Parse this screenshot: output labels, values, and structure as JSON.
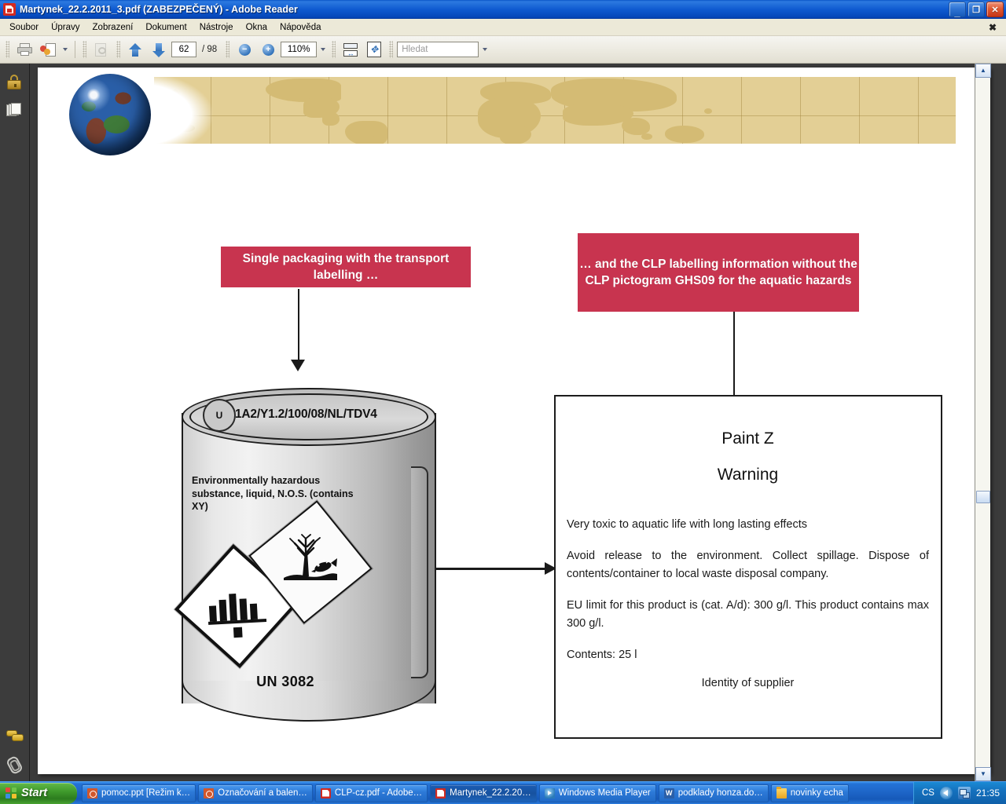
{
  "window": {
    "title": "Martynek_22.2.2011_3.pdf (ZABEZPEČENÝ) - Adobe Reader",
    "app_icon": "pdf-document-icon",
    "minimize_glyph": "_",
    "restore_glyph": "❐",
    "close_glyph": "✕"
  },
  "menu": {
    "items": [
      {
        "label": "Soubor"
      },
      {
        "label": "Úpravy"
      },
      {
        "label": "Zobrazení"
      },
      {
        "label": "Dokument"
      },
      {
        "label": "Nástroje"
      },
      {
        "label": "Okna"
      },
      {
        "label": "Nápověda"
      }
    ],
    "close_document_glyph": "✖"
  },
  "toolbar": {
    "print_icon": "printer-icon",
    "send_for_review_icon": "send-for-review-icon",
    "email_icon": "email-attach-icon",
    "previous_page_icon": "arrow-up-icon",
    "next_page_icon": "arrow-down-icon",
    "page_number": "62",
    "page_total": "/ 98",
    "zoom_out_glyph": "−",
    "zoom_in_glyph": "+",
    "zoom_value": "110%",
    "zoom_dropdown_icon": "chevron-down-icon",
    "fit_width_icon": "fit-width-icon",
    "fit_page_icon": "fit-page-icon",
    "search_placeholder": "Hledat",
    "search_value": "",
    "search_dropdown_icon": "chevron-down-icon"
  },
  "navigation_pane": {
    "items": [
      {
        "name": "security-lock-icon"
      },
      {
        "name": "page-thumbnails-icon"
      },
      {
        "name": "comments-icon"
      },
      {
        "name": "attachments-icon"
      }
    ]
  },
  "scrollbar": {
    "up_glyph": "▲",
    "down_glyph": "▼"
  },
  "document": {
    "banner": {
      "globe_icon": "globe-icon",
      "world_map_icon": "world-map-band"
    },
    "callout_left": "Single packaging with the transport labelling …",
    "callout_right": "… and the CLP labelling information without the CLP pictogram GHS09 for the aquatic hazards",
    "drum": {
      "un_approval_mark": "U",
      "un_packaging_code": "1A2/Y1.2/100/08/NL/TDV4",
      "proper_shipping_name": "Environmentally hazardous substance, liquid, N.O.S. (contains XY)",
      "un_number": "UN 3082",
      "pictograms": [
        {
          "name": "transport-class-9-pictogram",
          "label": "Class 9 miscellaneous dangerous goods"
        },
        {
          "name": "marine-pollutant-pictogram",
          "label": "Dead tree and dead fish marine pollutant mark"
        }
      ]
    },
    "clp_label": {
      "product_name": "Paint Z",
      "signal_word": "Warning",
      "hazard_statement": "Very toxic to aquatic life with long lasting effects",
      "precautionary_statements": "Avoid release to the environment. Collect spillage. Dispose of contents/container to local waste disposal company.",
      "voc_statement": "EU limit for this product is (cat. A/d): 300 g/l.  This product contains max 300 g/l.",
      "contents": "Contents: 25 l",
      "supplier": "Identity of supplier"
    }
  },
  "taskbar": {
    "start_label": "Start",
    "start_icon": "windows-flag-icon",
    "tasks": [
      {
        "label": "pomoc.ppt [Režim k…",
        "icon": "powerpoint-icon",
        "active": false
      },
      {
        "label": "Označování a balen…",
        "icon": "powerpoint-icon",
        "active": false
      },
      {
        "label": "CLP-cz.pdf - Adobe…",
        "icon": "pdf-icon",
        "active": false
      },
      {
        "label": "Martynek_22.2.20…",
        "icon": "pdf-icon",
        "active": true
      },
      {
        "label": "Windows Media Player",
        "icon": "media-player-icon",
        "active": false
      },
      {
        "label": "podklady honza.do…",
        "icon": "word-icon",
        "active": false
      },
      {
        "label": "novinky echa",
        "icon": "folder-icon",
        "active": false
      }
    ],
    "tray": {
      "language": "CS",
      "volume_icon": "volume-icon",
      "network_icon": "network-icon",
      "clock": "21:35"
    }
  },
  "colors": {
    "callout_red": "#c8344f",
    "banner_tan": "#e3cf95",
    "banner_land": "#d4bb74",
    "titlebar_blue": "#1559b8",
    "taskbar_blue": "#1e66c8"
  }
}
